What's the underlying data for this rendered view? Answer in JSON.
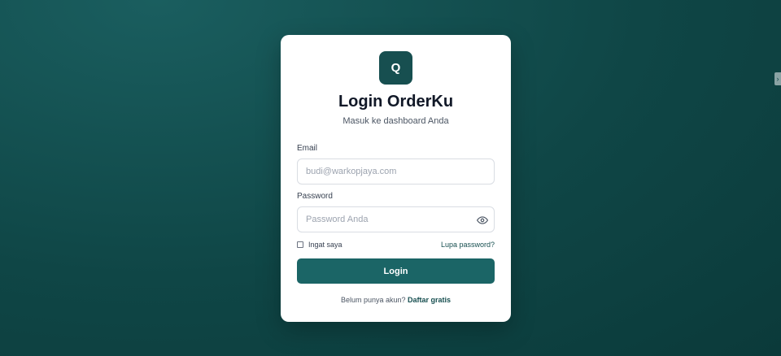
{
  "card": {
    "logo_letter": "Q",
    "title": "Login OrderKu",
    "subtitle": "Masuk ke dashboard Anda"
  },
  "form": {
    "email_label": "Email",
    "email_placeholder": "budi@warkopjaya.com",
    "email_value": "",
    "password_label": "Password",
    "password_placeholder": "Password Anda",
    "password_value": "",
    "remember_label": "Ingat saya",
    "remember_checked": false,
    "forgot_label": "Lupa password?",
    "submit_label": "Login"
  },
  "signup": {
    "prompt": "Belum punya akun?",
    "link_label": "Daftar gratis"
  },
  "colors": {
    "brand": "#174f50",
    "button": "#1b6566",
    "background": "#0f4646"
  },
  "icons": {
    "password_toggle": "eye-icon",
    "edge_handle": "chevron-right-icon"
  }
}
